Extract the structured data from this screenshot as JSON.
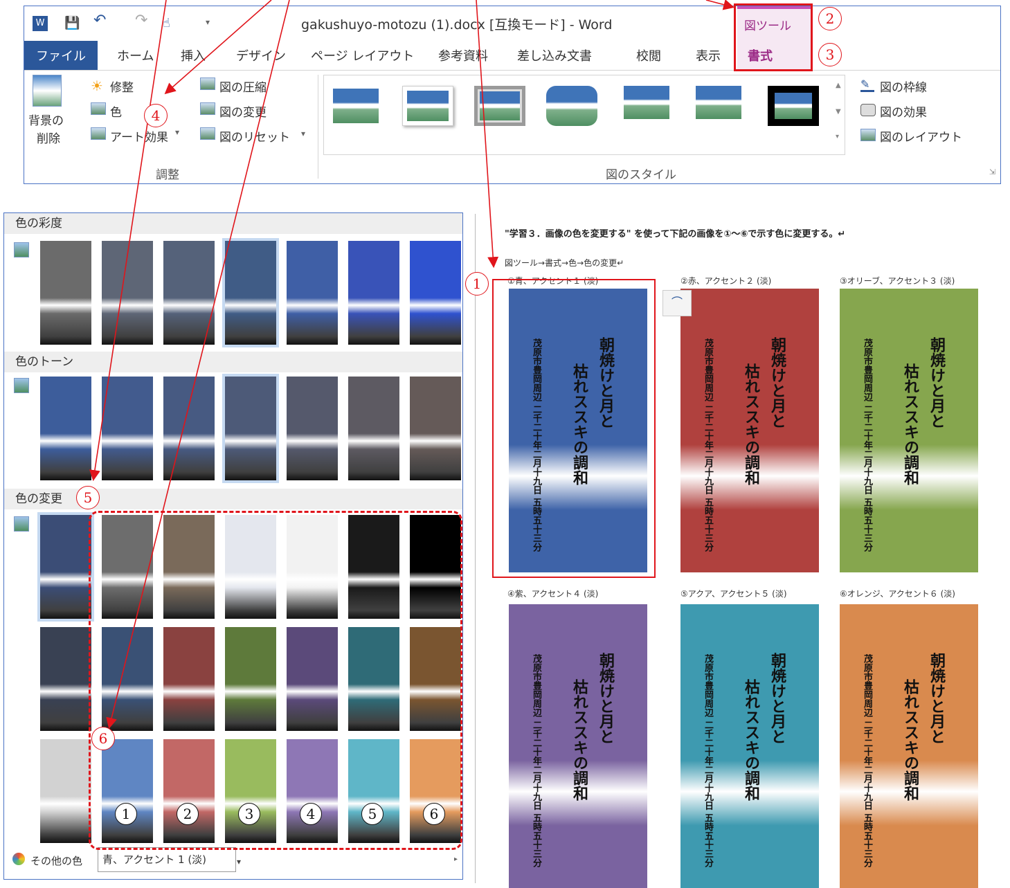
{
  "window": {
    "title": "gakushuyo-motozu (1).docx [互換モード] - Word"
  },
  "tabs": {
    "file": "ファイル",
    "items": [
      "ホーム",
      "挿入",
      "デザイン",
      "ページ レイアウト",
      "参考資料",
      "差し込み文書",
      "校閲",
      "表示"
    ],
    "context_group": "図ツール",
    "context_tab": "書式"
  },
  "ribbon": {
    "remove_bg": [
      "背景の",
      "削除"
    ],
    "adjust": {
      "corrections": "修整",
      "color": "色",
      "artistic": "アート効果",
      "compress": "図の圧縮",
      "change": "図の変更",
      "reset": "図のリセット",
      "group_label": "調整"
    },
    "styles": {
      "group_label": "図のスタイル",
      "border": "図の枠線",
      "effects": "図の効果",
      "layout": "図のレイアウト"
    }
  },
  "gallery": {
    "saturation": "色の彩度",
    "tone": "色のトーン",
    "recolor": "色の変更",
    "more_colors": "その他の色",
    "tooltip": "青、アクセント 1 (淡)",
    "saturation_colors": [
      "#6b6b6b",
      "#5e6676",
      "#55627a",
      "#405c86",
      "#3f5fa6",
      "#3953b8",
      "#2f52cf"
    ],
    "tone_colors": [
      "#3d5d9b",
      "#425b8e",
      "#475a82",
      "#4d5a78",
      "#55596c",
      "#5d5a62",
      "#655a58"
    ],
    "recolor_row1": [
      "#3b4d76",
      "#6d6d6d",
      "#7a6a5a",
      "#e4e7ee",
      "#f2f2f2",
      "#1a1a1a",
      "#000000"
    ],
    "recolor_row2": [
      "#394153",
      "#3a5175",
      "#8a4240",
      "#5e7a3b",
      "#5b4a7a",
      "#2f6b77",
      "#7a5530"
    ],
    "recolor_row3": [
      "#d2d2d2",
      "#5f86c3",
      "#c26866",
      "#99bb5e",
      "#8e77b5",
      "#5fb6c8",
      "#e59b5e"
    ],
    "numbers": [
      "1",
      "2",
      "3",
      "4",
      "5",
      "6"
    ]
  },
  "document": {
    "note": "\"学習３．画像の色を変更する\" を使って下記の画像を①～⑥で示す色に変更する。↵",
    "path": "図ツール→書式→色→色の変更↵",
    "images": [
      {
        "caption": "①青、アクセント１ (淡)",
        "color": "#3e63a8"
      },
      {
        "caption": "②赤、アクセント２ (淡)",
        "color": "#b0413e"
      },
      {
        "caption": "③オリーブ、アクセント３ (淡)",
        "color": "#86a64e"
      },
      {
        "caption": "④紫、アクセント４ (淡)",
        "color": "#7a63a0"
      },
      {
        "caption": "⑤アクア、アクセント５ (淡)",
        "color": "#3e9ab0"
      },
      {
        "caption": "⑥オレンジ、アクセント６ (淡)",
        "color": "#d98a4e"
      }
    ],
    "poem_line1": "朝焼けと月と",
    "poem_line2": "枯れススキの調和",
    "poem_line3": "茂原市豊岡周辺 二千二十年二月十九日 五時五十三分"
  },
  "annotations": [
    "1",
    "2",
    "3",
    "4",
    "5",
    "6"
  ],
  "colors": {
    "accent": "#2b579a",
    "context": "#9b2a86",
    "annotation": "#e0151b"
  }
}
